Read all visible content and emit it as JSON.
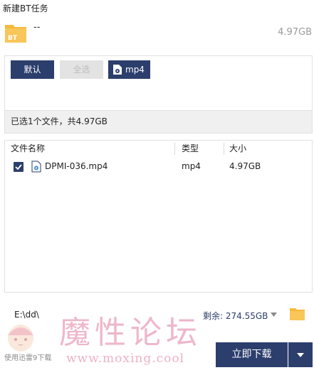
{
  "window": {
    "title": "新建BT任务"
  },
  "task": {
    "name": "--",
    "total_size": "4.97GB",
    "badge": "BT"
  },
  "filters": {
    "default_label": "默认",
    "select_all_label": "全选",
    "mp4_label": "mp4"
  },
  "summary": "已选1个文件，共4.97GB",
  "table": {
    "columns": [
      "文件名称",
      "类型",
      "大小"
    ],
    "rows": [
      {
        "checked": true,
        "name": "DPMI-036.mp4",
        "type": "mp4",
        "size": "4.97GB"
      }
    ]
  },
  "footer": {
    "save_path": "E:\\dd\\",
    "free_space": "剩余: 274.55GB",
    "hint": "使用迅雷9下载",
    "download_label": "立即下载"
  },
  "watermark": {
    "chars": "魔性论坛",
    "url": "www.moxing.cool"
  },
  "colors": {
    "accent": "#2c3e6c",
    "folder": "#f5b93e",
    "watermark": "#e9a0b7"
  }
}
